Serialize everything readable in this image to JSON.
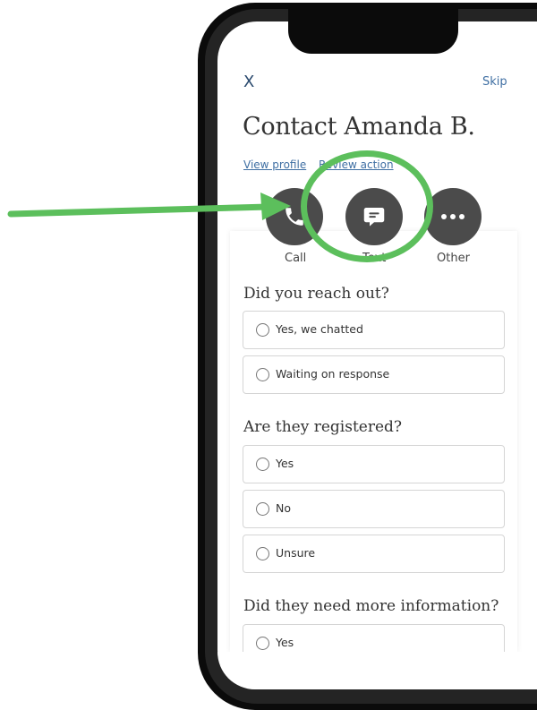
{
  "header": {
    "close_glyph": "X",
    "skip_label": "Skip"
  },
  "title": "Contact Amanda B.",
  "links": {
    "view_profile": "View profile",
    "review_action": "Review action"
  },
  "actions": [
    {
      "label": "Call",
      "icon": "phone-icon"
    },
    {
      "label": "Text",
      "icon": "chat-bubble-icon"
    },
    {
      "label": "Other",
      "icon": "more-dots-icon"
    }
  ],
  "questions": [
    {
      "heading": "Did you reach out?",
      "options": [
        "Yes, we chatted",
        "Waiting on response"
      ]
    },
    {
      "heading": "Are they registered?",
      "options": [
        "Yes",
        "No",
        "Unsure"
      ]
    },
    {
      "heading": "Did they need more information?",
      "options": [
        "Yes"
      ]
    }
  ],
  "colors": {
    "highlight": "#5cbf5c",
    "action_button": "#4b4b4b",
    "link": "#3f6fa3"
  }
}
